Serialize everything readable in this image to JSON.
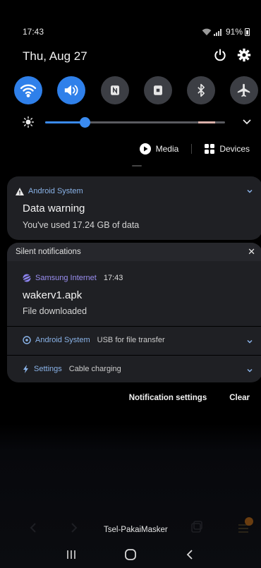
{
  "status_bar": {
    "time": "17:43",
    "battery": "91%"
  },
  "header": {
    "date": "Thu, Aug 27"
  },
  "quick_toggles": [
    {
      "name": "wifi",
      "state": "on"
    },
    {
      "name": "sound",
      "state": "on"
    },
    {
      "name": "nfc",
      "state": "off"
    },
    {
      "name": "screenshot",
      "state": "off"
    },
    {
      "name": "bluetooth",
      "state": "off"
    },
    {
      "name": "airplane",
      "state": "off"
    }
  ],
  "brightness": {
    "level": 0.22
  },
  "media_bar": {
    "media_label": "Media",
    "devices_label": "Devices"
  },
  "notifications": {
    "data_warning": {
      "app": "Android System",
      "title": "Data warning",
      "body": "You've used 17.24 GB of data"
    },
    "silent": {
      "header": "Silent notifications",
      "download": {
        "app": "Samsung Internet",
        "time": "17:43",
        "title": "wakerv1.apk",
        "body": "File downloaded"
      },
      "usb": {
        "app": "Android System",
        "text": "USB for file transfer"
      },
      "charging": {
        "app": "Settings",
        "text": "Cable charging"
      }
    }
  },
  "actions": {
    "settings_label": "Notification settings",
    "clear_label": "Clear"
  },
  "background": {
    "wifi_name": "Tsel-PakaiMasker"
  },
  "colors": {
    "accent": "#2f80ea",
    "card_bg": "#1f2024"
  }
}
